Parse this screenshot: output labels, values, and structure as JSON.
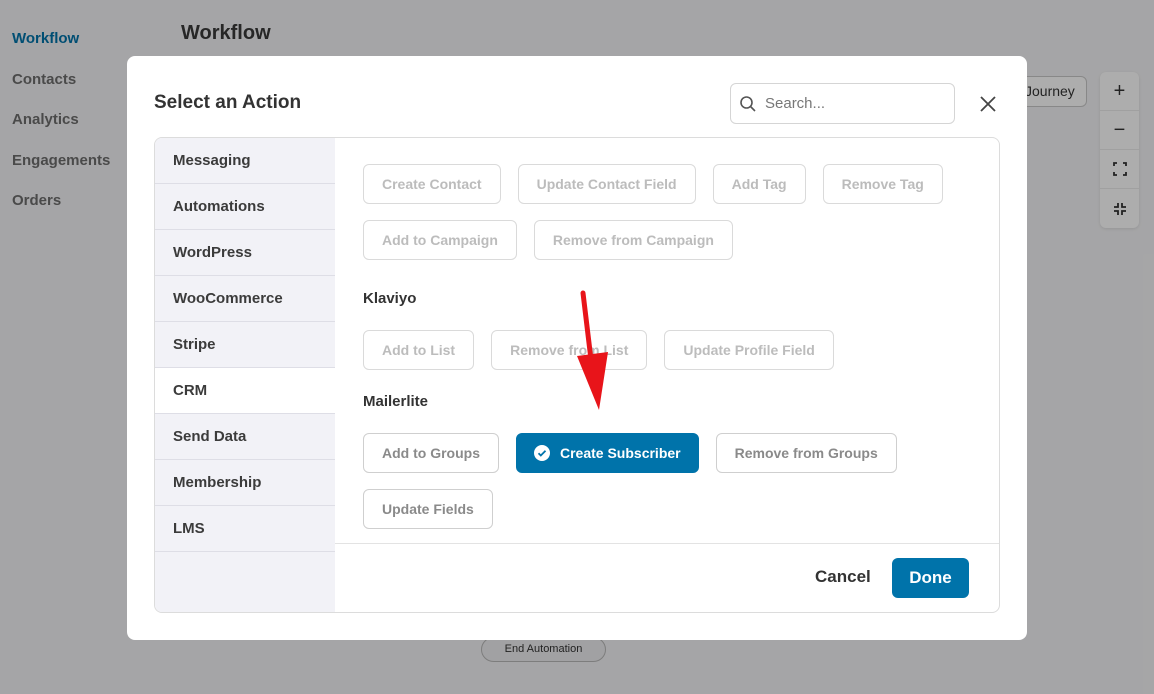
{
  "background": {
    "nav": [
      {
        "label": "Workflow",
        "active": true
      },
      {
        "label": "Contacts",
        "active": false
      },
      {
        "label": "Analytics",
        "active": false
      },
      {
        "label": "Engagements",
        "active": false
      },
      {
        "label": "Orders",
        "active": false
      }
    ],
    "page_title": "Workflow",
    "journey_button": "Journey",
    "zoom": {
      "zoom_in": "+",
      "zoom_out": "−",
      "fit_icon": "fit-screen-icon",
      "fullscreen_icon": "fullscreen-icon"
    },
    "end_automation": "End Automation"
  },
  "modal": {
    "title": "Select an Action",
    "search_placeholder": "Search...",
    "close_icon": "close-icon",
    "categories": [
      {
        "label": "Messaging",
        "active": false
      },
      {
        "label": "Automations",
        "active": false
      },
      {
        "label": "WordPress",
        "active": false
      },
      {
        "label": "WooCommerce",
        "active": false
      },
      {
        "label": "Stripe",
        "active": false
      },
      {
        "label": "CRM",
        "active": true
      },
      {
        "label": "Send Data",
        "active": false
      },
      {
        "label": "Membership",
        "active": false
      },
      {
        "label": "LMS",
        "active": false
      }
    ],
    "sections": [
      {
        "title": "",
        "rows": [
          [
            "Create Contact",
            "Update Contact Field",
            "Add Tag",
            "Remove Tag"
          ],
          [
            "Add to Campaign",
            "Remove from Campaign"
          ]
        ]
      },
      {
        "title": "Klaviyo",
        "rows": [
          [
            "Add to List",
            "Remove from List",
            "Update Profile Field"
          ]
        ]
      },
      {
        "title": "Mailerlite",
        "rows": [
          [
            "Add to Groups",
            "Create Subscriber",
            "Remove from Groups"
          ],
          [
            "Update Fields"
          ]
        ]
      }
    ],
    "selected_action": "Create Subscriber",
    "cancel_label": "Cancel",
    "done_label": "Done",
    "accent_color": "#0073aa",
    "annotation_arrow_color": "#e8141a"
  }
}
